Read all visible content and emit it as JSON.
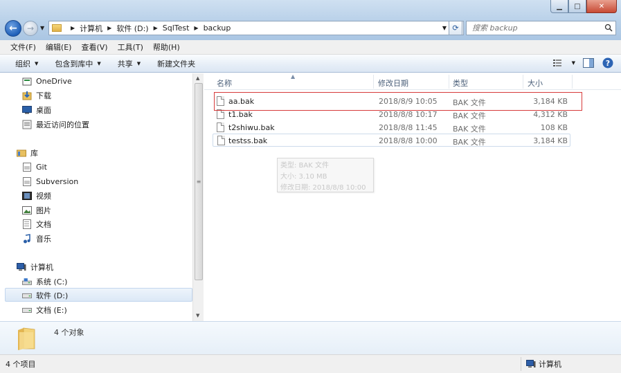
{
  "address": {
    "crumbs": [
      "计算机",
      "软件 (D:)",
      "SqlTest",
      "backup"
    ]
  },
  "search": {
    "placeholder": "搜索 backup"
  },
  "menu": [
    "文件(F)",
    "编辑(E)",
    "查看(V)",
    "工具(T)",
    "帮助(H)"
  ],
  "toolbar": {
    "organize": "组织",
    "include_library": "包含到库中",
    "share": "共享",
    "new_folder": "新建文件夹"
  },
  "nav": {
    "favorites": [
      {
        "label": "OneDrive",
        "icon": "onedrive-icon"
      },
      {
        "label": "下载",
        "icon": "downloads-icon"
      },
      {
        "label": "桌面",
        "icon": "desktop-icon"
      },
      {
        "label": "最近访问的位置",
        "icon": "recent-places-icon"
      }
    ],
    "libraries_label": "库",
    "libraries": [
      {
        "label": "Git",
        "icon": "library-icon"
      },
      {
        "label": "Subversion",
        "icon": "library-icon"
      },
      {
        "label": "视频",
        "icon": "video-icon"
      },
      {
        "label": "图片",
        "icon": "pictures-icon"
      },
      {
        "label": "文档",
        "icon": "documents-icon"
      },
      {
        "label": "音乐",
        "icon": "music-icon"
      }
    ],
    "computer_label": "计算机",
    "drives": [
      {
        "label": "系统 (C:)",
        "icon": "system-drive-icon"
      },
      {
        "label": "软件 (D:)",
        "icon": "drive-icon"
      },
      {
        "label": "文档 (E:)",
        "icon": "drive-icon"
      }
    ]
  },
  "columns": {
    "name": "名称",
    "modified": "修改日期",
    "type": "类型",
    "size": "大小"
  },
  "files": [
    {
      "name": "aa.bak",
      "modified": "2018/8/9 10:05",
      "type": "BAK 文件",
      "size": "3,184 KB"
    },
    {
      "name": "t1.bak",
      "modified": "2018/8/8 10:17",
      "type": "BAK 文件",
      "size": "4,312 KB"
    },
    {
      "name": "t2shiwu.bak",
      "modified": "2018/8/8 11:45",
      "type": "BAK 文件",
      "size": "108 KB"
    },
    {
      "name": "testss.bak",
      "modified": "2018/8/8 10:00",
      "type": "BAK 文件",
      "size": "3,184 KB"
    }
  ],
  "tooltip": {
    "line1": "类型: BAK 文件",
    "line2": "大小: 3.10 MB",
    "line3": "修改日期: 2018/8/8 10:00"
  },
  "details": {
    "count": "4 个对象"
  },
  "status": {
    "items": "4 个项目",
    "location": "计算机"
  },
  "colors": {
    "highlight": "#d63a3a",
    "accent": "#1f5fb8"
  }
}
